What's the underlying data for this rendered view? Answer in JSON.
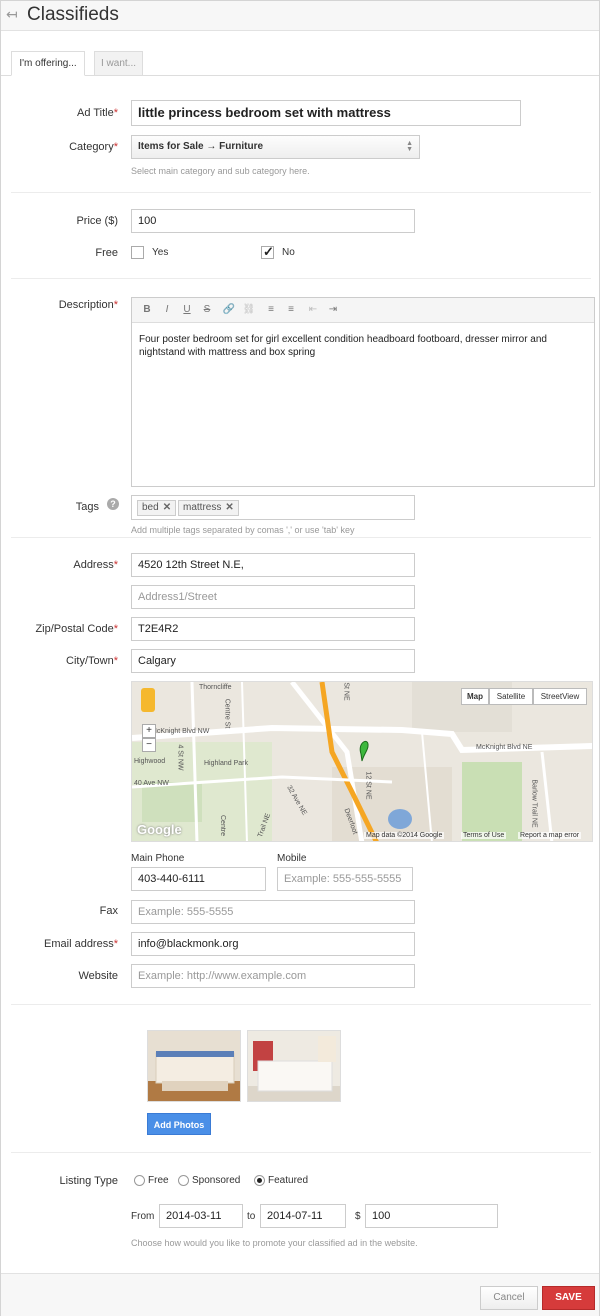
{
  "header": {
    "title": "Classifieds",
    "back_icon": "back-arrow-icon"
  },
  "tabs": [
    {
      "label": "I'm offering...",
      "active": true
    },
    {
      "label": "I want...",
      "active": false
    }
  ],
  "form": {
    "ad_title": {
      "label": "Ad Title",
      "value": "little princess bedroom set with mattress"
    },
    "category": {
      "label": "Category",
      "value": "Items for Sale → Furniture",
      "hint": "Select main category and sub category here."
    },
    "price": {
      "label": "Price ($)",
      "value": "100"
    },
    "free": {
      "label": "Free",
      "yes": "Yes",
      "no": "No",
      "selected": "No"
    },
    "description": {
      "label": "Description",
      "toolbar": [
        "B",
        "I",
        "U",
        "S",
        "🔗",
        "⛓",
        "≡",
        "≡",
        "⇤",
        "⇥"
      ],
      "value": "Four poster bedroom set for girl excellent condition headboard footboard, dresser mirror and nightstand with mattress and box spring"
    },
    "tags": {
      "label": "Tags",
      "items": [
        "bed",
        "mattress"
      ],
      "hint": "Add multiple tags separated by comas ',' or use 'tab' key"
    },
    "address": {
      "label": "Address",
      "value": "4520 12th Street N.E,",
      "line2_placeholder": "Address1/Street"
    },
    "zip": {
      "label": "Zip/Postal Code",
      "value": "T2E4R2"
    },
    "city": {
      "label": "City/Town",
      "value": "Calgary"
    },
    "map": {
      "buttons": [
        "Map",
        "Satellite",
        "StreetView"
      ],
      "labels": [
        "Thorncliffe",
        "McKnight Blvd NW",
        "Highland Park",
        "Highwood",
        "40 Ave NW",
        "McKnight Blvd NE",
        "Barlow Trail NE",
        "Deerfoot",
        "12 St NE",
        "32 Ave NE",
        "Centre St",
        "4 St NW",
        "Centre",
        "Trail NE",
        "St NE"
      ],
      "footer": [
        "Map data ©2014 Google",
        "Terms of Use",
        "Report a map error"
      ],
      "logo": "Google"
    },
    "main_phone": {
      "label": "Main Phone",
      "value": "403-440-6111"
    },
    "mobile": {
      "label": "Mobile",
      "placeholder": "Example: 555-555-5555"
    },
    "fax": {
      "label": "Fax",
      "placeholder": "Example: 555-5555"
    },
    "email": {
      "label": "Email address",
      "value": "info@blackmonk.org"
    },
    "website": {
      "label": "Website",
      "placeholder": "Example: http://www.example.com"
    },
    "photos": {
      "button": "Add Photos"
    },
    "listing_type": {
      "label": "Listing Type",
      "options": [
        "Free",
        "Sponsored",
        "Featured"
      ],
      "selected": "Featured",
      "from_label": "From",
      "from": "2014-03-11",
      "to_label": "to",
      "to": "2014-07-11",
      "currency": "$",
      "amount": "100",
      "hint": "Choose how would you like to promote your classified ad in the website."
    }
  },
  "footer": {
    "cancel": "Cancel",
    "save": "SAVE"
  }
}
